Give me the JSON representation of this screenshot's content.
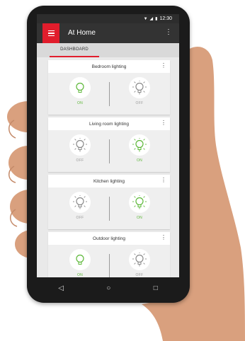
{
  "status": {
    "time": "12:30"
  },
  "app": {
    "title": "At Home",
    "menu_icon": "hamburger-icon",
    "overflow_icon": "more-vert-icon"
  },
  "tabs": [
    {
      "label": "DASHBOARD",
      "active": true
    }
  ],
  "colors": {
    "accent": "#e11d2c",
    "on": "#5db839",
    "off": "#9a9a9a"
  },
  "cards": [
    {
      "title": "Bedroom lighting",
      "left": {
        "label": "ON",
        "state": "on"
      },
      "right": {
        "label": "OFF",
        "state": "off"
      }
    },
    {
      "title": "Living room lighting",
      "left": {
        "label": "OFF",
        "state": "off"
      },
      "right": {
        "label": "ON",
        "state": "on"
      }
    },
    {
      "title": "Kitchen lighting",
      "left": {
        "label": "OFF",
        "state": "off"
      },
      "right": {
        "label": "ON",
        "state": "on"
      }
    },
    {
      "title": "Outdoor lighting",
      "left": {
        "label": "ON",
        "state": "on"
      },
      "right": {
        "label": "OFF",
        "state": "off"
      }
    }
  ],
  "navbar": {
    "back": "◁",
    "home": "○",
    "recents": "□"
  }
}
